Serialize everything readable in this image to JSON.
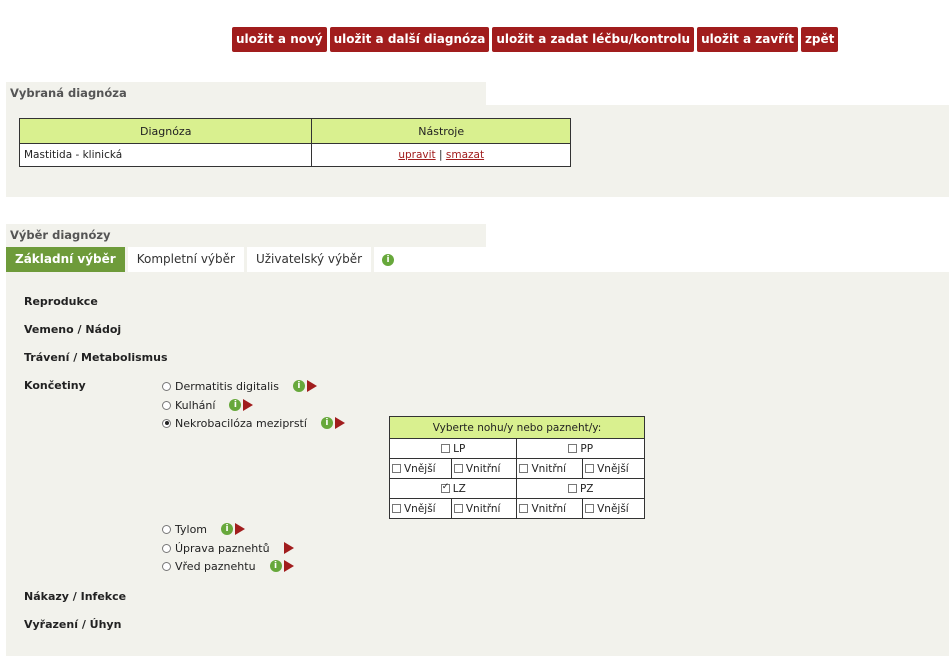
{
  "toolbar": {
    "save_new": "uložit a nový",
    "save_next_diag": "uložit a další diagnóza",
    "save_treatment": "uložit a zadat léčbu/kontrolu",
    "save_close": "uložit a zavřít",
    "back": "zpět"
  },
  "selected": {
    "header": "Vybraná diagnóza",
    "col_diag": "Diagnóza",
    "col_tools": "Nástroje",
    "row_diag": "Mastitida - klinická",
    "edit": "upravit",
    "sep": "|",
    "delete": "smazat"
  },
  "choice": {
    "header": "Výběr diagnózy",
    "tabs": [
      "Základní výběr",
      "Kompletní výběr",
      "Uživatelský výběr"
    ],
    "info": "i"
  },
  "categories": {
    "reprodukce": "Reprodukce",
    "vemeno": "Vemeno / Nádoj",
    "traveni": "Trávení / Metabolismus",
    "koncetiny": "Končetiny",
    "nakazy": "Nákazy / Infekce",
    "vyrazeni": "Vyřazení / Úhyn"
  },
  "limb_options": [
    {
      "label": "Dermatitis digitalis",
      "checked": false
    },
    {
      "label": "Kulhání",
      "checked": false
    },
    {
      "label": "Nekrobacilóza meziprstí",
      "checked": true
    },
    {
      "label": "Tylom",
      "checked": false
    },
    {
      "label": "Úprava paznehtů",
      "checked": false
    },
    {
      "label": "Vřed paznehtu",
      "checked": false
    }
  ],
  "legs": {
    "title": "Vyberte nohu/y nebo pazneht/y:",
    "lp": "LP",
    "pp": "PP",
    "lz": "LZ",
    "pz": "PZ",
    "vnejsi": "Vnější",
    "vnitrni": "Vnitřní",
    "lz_checked": true
  }
}
